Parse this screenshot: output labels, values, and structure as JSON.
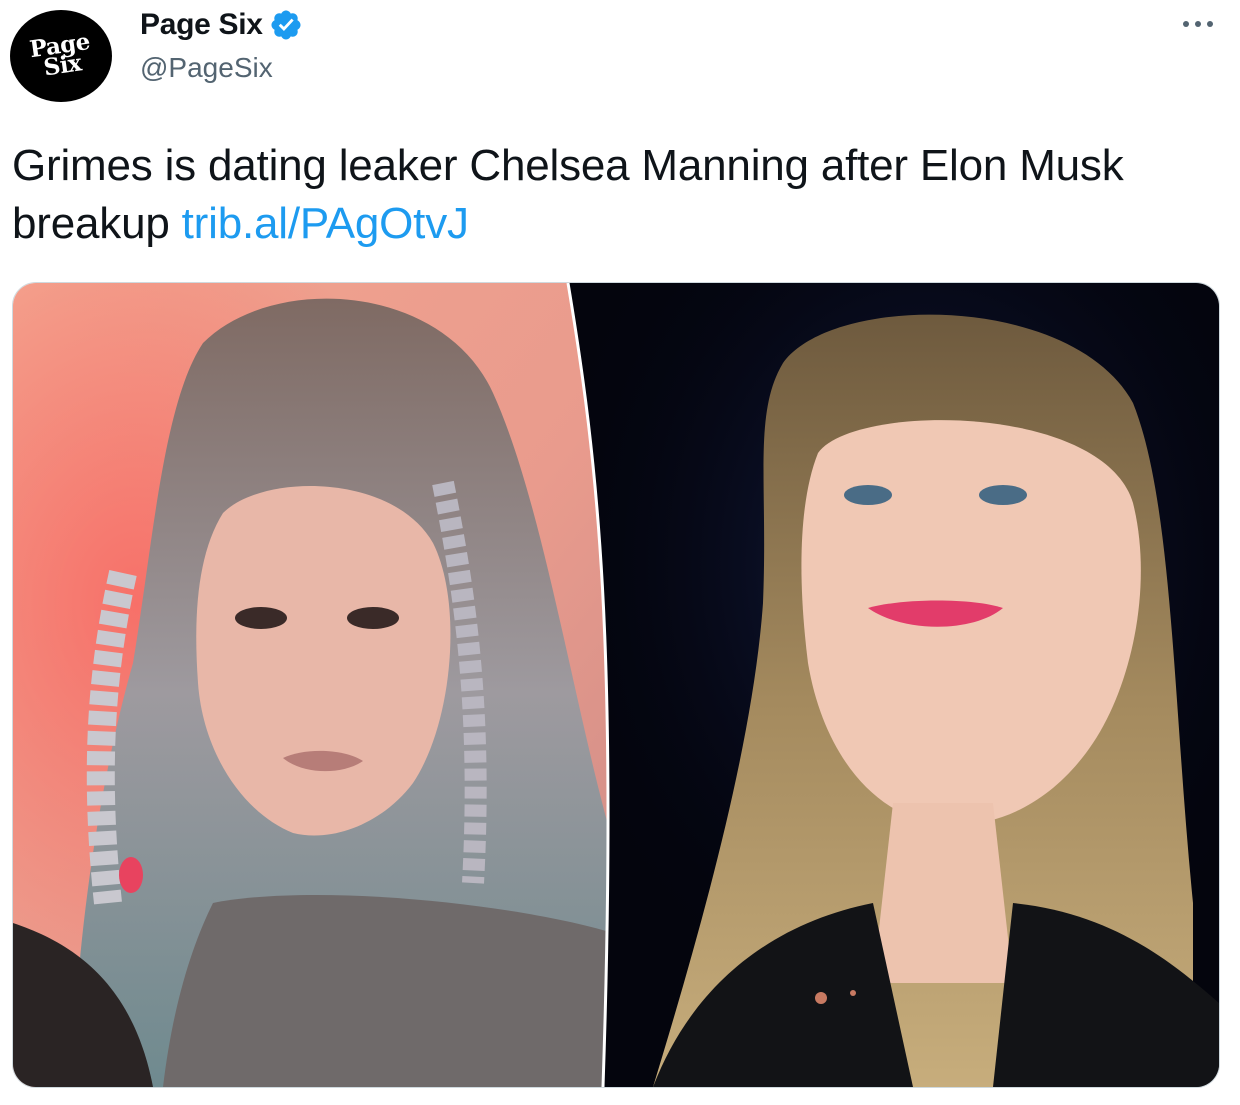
{
  "account": {
    "avatar_text": "Page\nSix",
    "display_name": "Page Six",
    "handle": "@PageSix",
    "verified": true
  },
  "tweet": {
    "text": "Grimes is dating leaker Chelsea Manning after Elon Musk breakup ",
    "link_text": "trib.al/PAgOtvJ"
  },
  "icons": {
    "verified": "verified-badge-icon",
    "more": "more-options-icon"
  },
  "colors": {
    "link": "#1d9bf0",
    "verified": "#1d9bf0",
    "handle": "#536471"
  }
}
